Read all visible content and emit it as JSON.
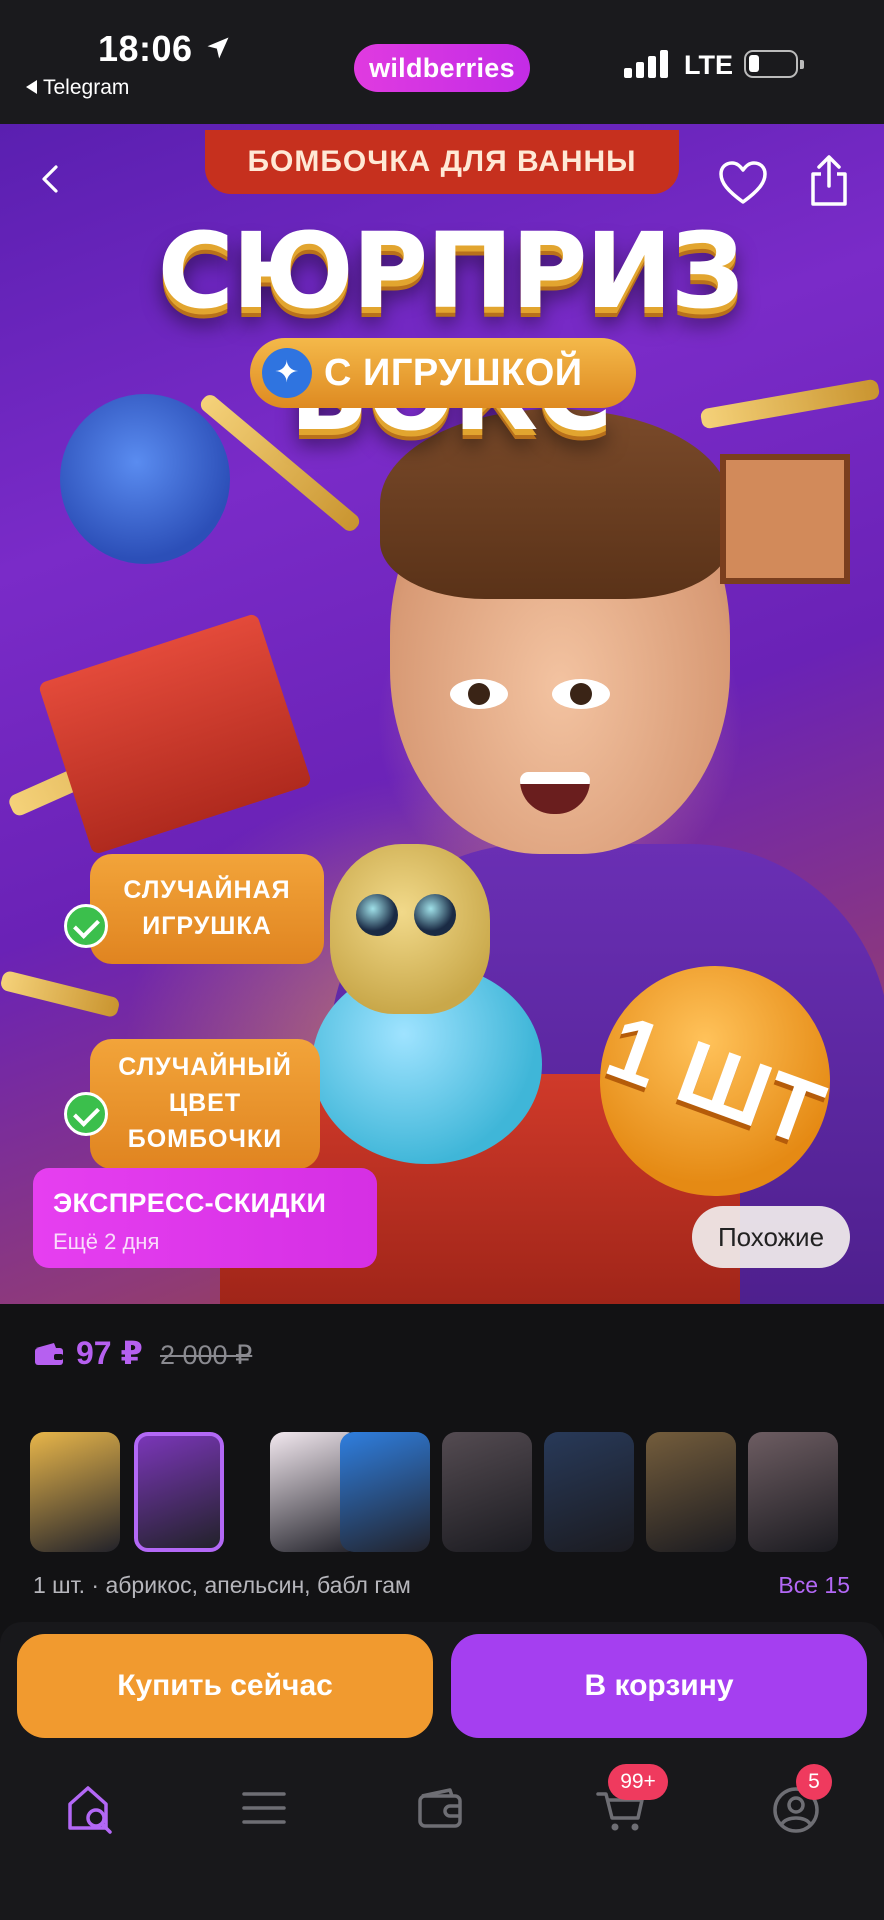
{
  "status_bar": {
    "time": "18:06",
    "back_app": "Telegram",
    "brand": "wildberries",
    "network": "LTE"
  },
  "hero": {
    "top_banner": "БОМБОЧКА ДЛЯ ВАННЫ",
    "title": "СЮРПРИЗ БОКС",
    "pill": "С ИГРУШКОЙ",
    "feature_1": [
      "СЛУЧАЙНАЯ",
      "ИГРУШКА"
    ],
    "feature_2": [
      "СЛУЧАЙНЫЙ",
      "ЦВЕТ",
      "БОМБОЧКИ"
    ],
    "sticker": "1 ШТ",
    "express_title": "ЭКСПРЕСС-СКИДКИ",
    "express_sub": "Ещё 2 дня",
    "similar": "Похожие"
  },
  "price": {
    "current": "97 ₽",
    "old": "2 000 ₽"
  },
  "variants": {
    "description": "1 шт. · абрикос, апельсин, бабл гам",
    "all_label": "Все 15",
    "thumbs": [
      {
        "color": "#e8b64a"
      },
      {
        "color": "#7a36b8"
      },
      {
        "color": "#f2e8ef"
      },
      {
        "color": "#2f7fe0"
      },
      {
        "color": "#8a7a84"
      },
      {
        "color": "#3a5a92"
      },
      {
        "color": "#c49a5c"
      },
      {
        "color": "#b89aa2"
      }
    ]
  },
  "actions": {
    "buy_now": "Купить сейчас",
    "add_to_cart": "В корзину"
  },
  "nav": {
    "cart_badge": "99+",
    "profile_badge": "5"
  },
  "colors": {
    "accent": "#a53ff0",
    "buy_button": "#f19a2f",
    "badge": "#ef3a5e"
  }
}
